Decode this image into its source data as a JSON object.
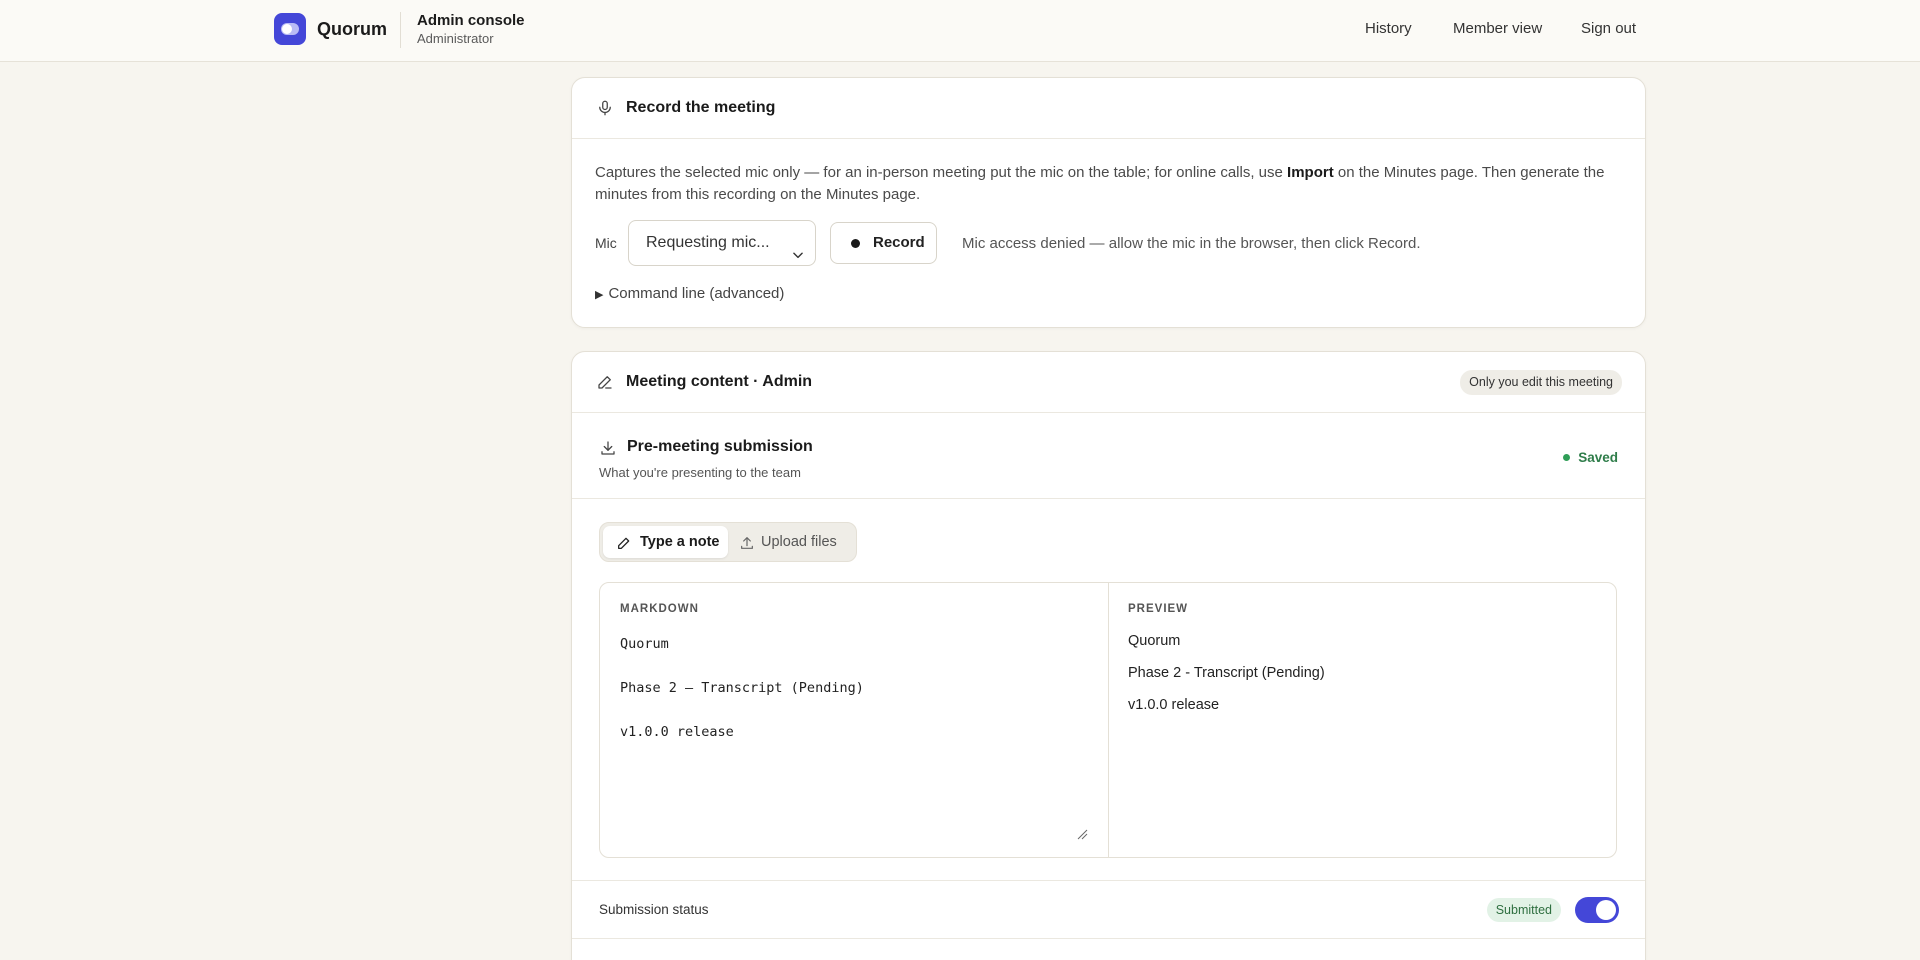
{
  "header": {
    "brand": "Quorum",
    "console_title": "Admin console",
    "console_role": "Administrator",
    "nav": [
      "History",
      "Member view",
      "Sign out"
    ]
  },
  "record": {
    "title": "Record the meeting",
    "desc_1": "Captures the selected mic only — for an in-person meeting put the mic on the table; for online calls, use ",
    "desc_bold": "Import",
    "desc_2": " on the Minutes page. Then generate the minutes from this recording on the Minutes page.",
    "mic_label": "Mic",
    "mic_value": "Requesting mic...",
    "record_label": "Record",
    "status": "Mic access denied — allow the mic in the browser, then click Record.",
    "cmdline": "Command line (advanced)"
  },
  "content": {
    "title": "Meeting content · Admin",
    "badge": "Only you edit this meeting",
    "submission_title": "Pre-meeting submission",
    "submission_sub": "What you're presenting to the team",
    "saved": "Saved",
    "tab_note": "Type a note",
    "tab_upload": "Upload files",
    "markdown_label": "MARKDOWN",
    "markdown_text": "Quorum\n\nPhase 2 – Transcript (Pending)\n\nv1.0.0 release",
    "preview_label": "PREVIEW",
    "preview_lines": [
      "Quorum",
      "Phase 2 - Transcript (Pending)",
      "v1.0.0 release"
    ],
    "status_label": "Submission status",
    "status_badge": "Submitted",
    "toggle_on": true
  },
  "colors": {
    "accent": "#4447d8",
    "saved_green": "#2f7d4a",
    "background": "#f7f5ef"
  }
}
